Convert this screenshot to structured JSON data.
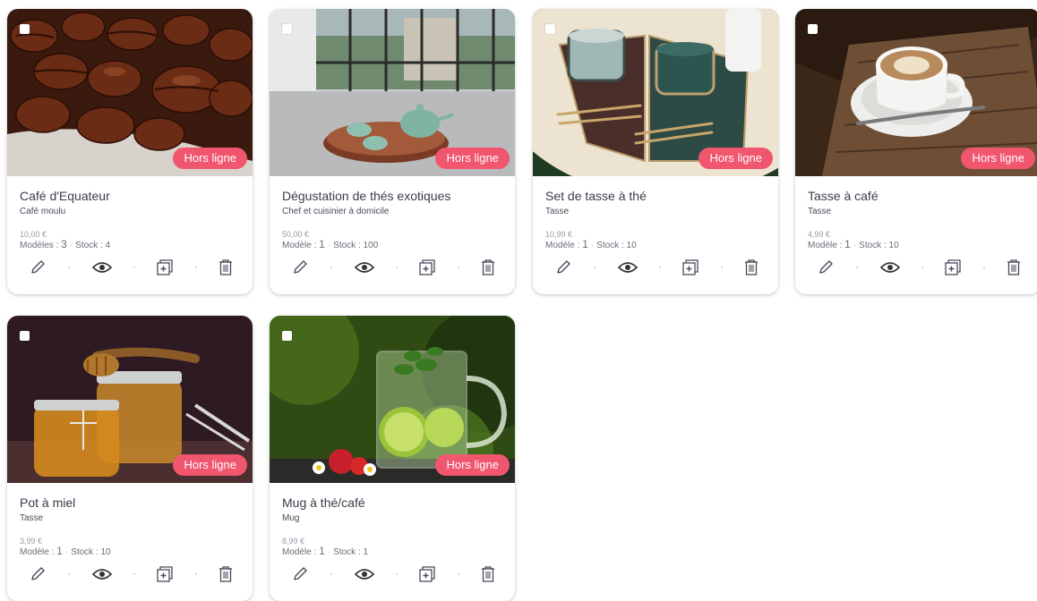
{
  "products": [
    {
      "title": "Café d'Equateur",
      "category": "Café moulu",
      "price": "10,00 €",
      "models_label": "Modèles : ",
      "models_count": "3",
      "stock_label": "Stock : ",
      "stock_count": "4",
      "status": "Hors ligne",
      "image": "coffee-beans"
    },
    {
      "title": "Dégustation de thés exotiques",
      "category": "Chef et cuisinier à domicile",
      "price": "50,00 €",
      "models_label": "Modèle : ",
      "models_count": "1",
      "stock_label": "Stock : ",
      "stock_count": "100",
      "status": "Hors ligne",
      "image": "tea-set-window"
    },
    {
      "title": "Set de tasse à thé",
      "category": "Tasse",
      "price": "10,99 €",
      "models_label": "Modèle : ",
      "models_count": "1",
      "stock_label": "Stock : ",
      "stock_count": "10",
      "status": "Hors ligne",
      "image": "cup-set-table"
    },
    {
      "title": "Tasse à café",
      "category": "Tasse",
      "price": "4,99 €",
      "models_label": "Modèle : ",
      "models_count": "1",
      "stock_label": "Stock : ",
      "stock_count": "10",
      "status": "Hors ligne",
      "image": "coffee-cup-wood"
    },
    {
      "title": "Pot à miel",
      "category": "Tasse",
      "price": "3,99 €",
      "models_label": "Modèle : ",
      "models_count": "1",
      "stock_label": "Stock : ",
      "stock_count": "10",
      "status": "Hors ligne",
      "image": "honey-jars"
    },
    {
      "title": "Mug à thé/café",
      "category": "Mug",
      "price": "8,99 €",
      "models_label": "Modèle : ",
      "models_count": "1",
      "stock_label": "Stock : ",
      "stock_count": "1",
      "status": "Hors ligne",
      "image": "glass-mug-mint"
    }
  ],
  "actions": {
    "edit_icon": "pencil-icon",
    "view_icon": "eye-icon",
    "duplicate_icon": "duplicate-icon",
    "delete_icon": "trash-icon"
  },
  "colors": {
    "badge": "#f0566e",
    "card_bg": "#ffffff",
    "icon": "#4a4a5a"
  }
}
